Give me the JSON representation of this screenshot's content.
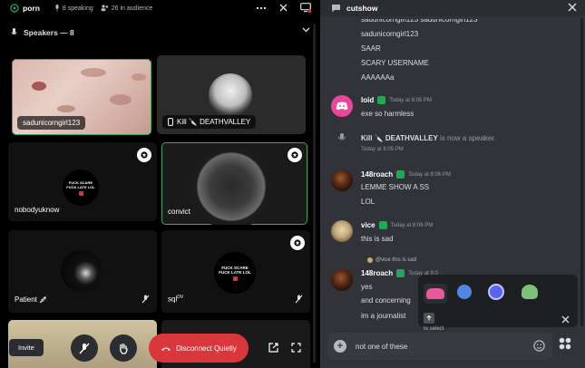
{
  "stage": {
    "channel_name": "porn",
    "speaking_count": "8 speaking",
    "audience_count": "26 in audience",
    "speakers_header": "Speakers — 8",
    "tiles": [
      {
        "name": "sadunicorngirl123"
      },
      {
        "name": "Kill 🔪 DEATHVALLEY"
      },
      {
        "name": "nobodyuknow"
      },
      {
        "name": "convict"
      },
      {
        "name": "Patient 💉"
      },
      {
        "name": "sql"
      }
    ],
    "tile_texts": {
      "fuck_scare": "FUCK SCARE\nFUCK LATE LOL"
    },
    "sql_superscript": "DV",
    "invite_label": "Invite",
    "disconnect_label": "Disconnect Quietly"
  },
  "chat": {
    "title": "cutshow",
    "lines_top": [
      "sadunicorngirl123 sadunicorngirl123",
      "sadunicorngirl123",
      "SAAR",
      "SCARY USERNAME",
      "AAAAAAa"
    ],
    "messages": [
      {
        "user": "loid",
        "time": "Today at 8:05 PM",
        "lines": [
          "exe so harmless"
        ]
      },
      {
        "system_user": "Kill 🔪 DEATHVALLEY",
        "system_text": " is now a speaker.",
        "time": "Today at 8:05 PM"
      },
      {
        "user": "148roach",
        "time": "Today at 8:06 PM",
        "lines": [
          "LEMME SHOW A SS",
          "LOL"
        ]
      },
      {
        "user": "vice",
        "time": "Today at 8:06 PM",
        "lines": [
          "this is sad"
        ]
      },
      {
        "reply": "@vice this is sad",
        "user": "148roach",
        "time": "Today at 8:0",
        "lines": [
          "yes",
          "and concerning",
          "im a journalist"
        ]
      }
    ],
    "sticker_hint": "to select",
    "composer_text": "not one of these"
  }
}
